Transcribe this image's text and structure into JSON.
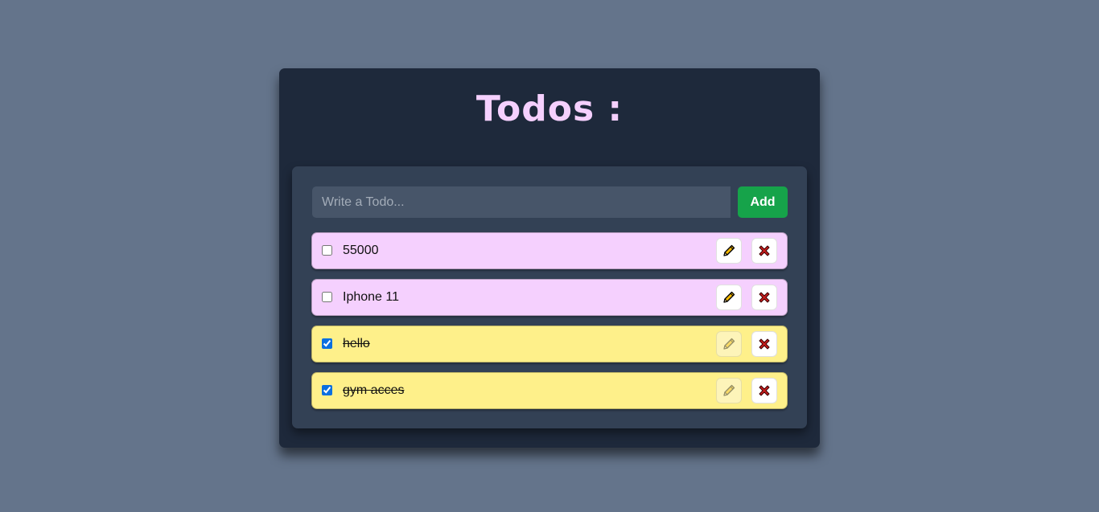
{
  "app": {
    "title": "Todos :"
  },
  "form": {
    "placeholder": "Write a Todo...",
    "value": "",
    "add_label": "Add"
  },
  "todos": [
    {
      "text": "55000",
      "completed": false
    },
    {
      "text": "Iphone 11",
      "completed": false
    },
    {
      "text": "hello",
      "completed": true
    },
    {
      "text": "gym acces",
      "completed": true
    }
  ],
  "icons": {
    "edit": "pencil-icon",
    "delete": "close-icon"
  },
  "colors": {
    "page_bg": "#64748b",
    "card_bg": "#1e293b",
    "panel_bg": "#334155",
    "title": "#f5d0fe",
    "pending_item": "#f5d0fe",
    "done_item": "#fef08a",
    "add_button": "#16a34a"
  }
}
